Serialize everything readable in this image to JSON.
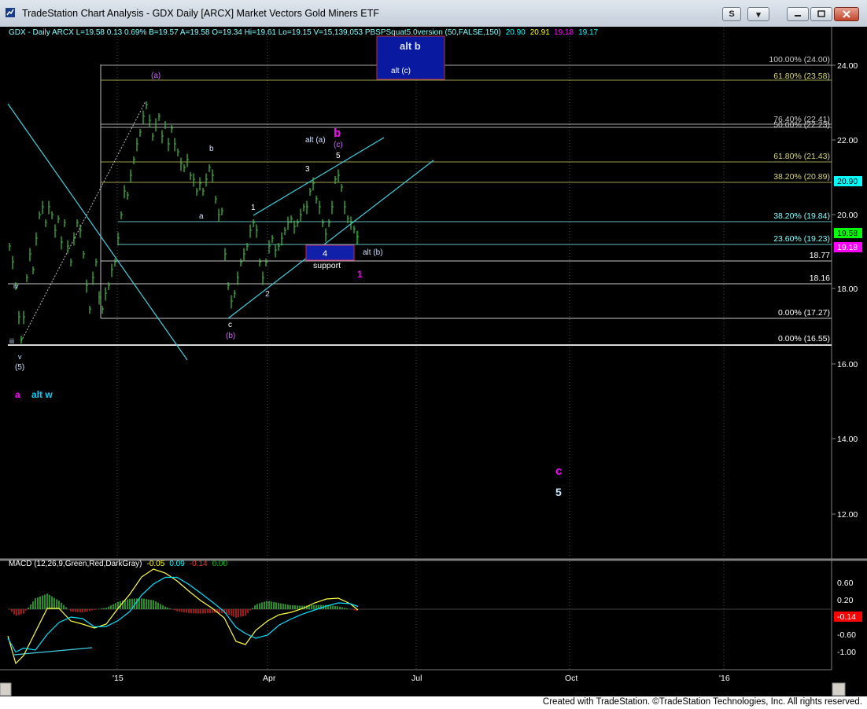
{
  "window": {
    "title": "TradeStation Chart Analysis - GDX Daily [ARCX] Market Vectors Gold Miners ETF",
    "buttons": {
      "s": "S",
      "menu": "▾"
    }
  },
  "status_bar": {
    "credit": "Created with TradeStation. ©TradeStation Technologies, Inc. All rights reserved."
  },
  "price_header": {
    "items": [
      {
        "text": "GDX - Daily  ARCX  L=19.58  0.13  0.69%  B=19.57  A=19.58  O=19.34  Hi=19.61  Lo=19.15  V=15,139,053  PBSPSquat5.0version (50,FALSE,150)",
        "color": "#7fffff"
      },
      {
        "text": "20.90",
        "color": "#00ffff"
      },
      {
        "text": "20.91",
        "color": "#ffff00"
      },
      {
        "text": "19.18",
        "color": "#ff00ff"
      },
      {
        "text": "19.17",
        "color": "#00ffff"
      }
    ]
  },
  "macd_header": {
    "items": [
      {
        "text": "MACD (12,26,9,Green,Red,DarkGray)",
        "color": "#ffffff"
      },
      {
        "text": "-0.05",
        "color": "#ffff00"
      },
      {
        "text": "0.09",
        "color": "#00ffff"
      },
      {
        "text": "-0.14",
        "color": "#ff3030"
      },
      {
        "text": "0.00",
        "color": "#00c000"
      }
    ]
  },
  "price_axis": {
    "ticks": [
      "24.00",
      "22.00",
      "20.00",
      "18.00",
      "16.00",
      "14.00",
      "12.00"
    ]
  },
  "macd_axis": {
    "ticks": [
      "0.60",
      "0.20",
      "-0.20",
      "-0.60",
      "-1.00"
    ]
  },
  "price_markers": [
    {
      "label": "20.90",
      "bg": "#00ffff",
      "fg": "#000000"
    },
    {
      "label": "19.58",
      "bg": "#00ff00",
      "fg": "#000000"
    },
    {
      "label": "19.18",
      "bg": "#ff00ff",
      "fg": "#ffffff"
    }
  ],
  "macd_marker": {
    "label": "-0.14",
    "bg": "#ff0000",
    "fg": "#ffffff"
  },
  "x_axis": {
    "labels": [
      "'15",
      "Apr",
      "Jul",
      "Oct",
      "'16"
    ]
  },
  "fib_levels": [
    {
      "label": "100.00% (24.00)",
      "color": "#c8c8c8"
    },
    {
      "label": "61.80% (23.58)",
      "color": "#d8d870"
    },
    {
      "label": "76.40% (22.41)",
      "color": "#c8c8c8"
    },
    {
      "label": "50.00% (22.23)",
      "color": "#c8c8c8"
    },
    {
      "label": "61.80% (21.43)",
      "color": "#d8d870"
    },
    {
      "label": "38.20% (20.89)",
      "color": "#d8d870"
    },
    {
      "label": "38.20% (19.84)",
      "color": "#80ffff"
    },
    {
      "label": "23.60% (19.23)",
      "color": "#80ffff"
    },
    {
      "label": "18.77",
      "color": "#ffffff"
    },
    {
      "label": "18.16",
      "color": "#ffffff"
    },
    {
      "label": "0.00% (17.27)",
      "color": "#ffffff"
    },
    {
      "label": "0.00% (16.55)",
      "color": "#ffffff"
    }
  ],
  "boxes": {
    "alt_b": {
      "title": "alt b",
      "sub": "alt (c)"
    },
    "support": {
      "inner": "4",
      "caption": "support"
    }
  },
  "wave_labels": [
    {
      "text": "(a)",
      "color": "#d060ff"
    },
    {
      "text": "b",
      "color": "#d0e0ff"
    },
    {
      "text": "a",
      "color": "#d0e0ff"
    },
    {
      "text": "1",
      "color": "#ffffff"
    },
    {
      "text": "2",
      "color": "#d0e0ff"
    },
    {
      "text": "3",
      "color": "#ffffff"
    },
    {
      "text": "4",
      "color": "#ffffff"
    },
    {
      "text": "5",
      "color": "#ffffff"
    },
    {
      "text": "c",
      "color": "#ffffff"
    },
    {
      "text": "(b)",
      "color": "#d060ff"
    },
    {
      "text": "(c)",
      "color": "#d060ff"
    },
    {
      "text": "alt (a)",
      "color": "#d0e0ff"
    },
    {
      "text": "b",
      "color": "#ff00ff"
    },
    {
      "text": "alt (b)",
      "color": "#d0e0ff"
    },
    {
      "text": "1",
      "color": "#ff00ff"
    },
    {
      "text": "iv",
      "color": "#d0e0ff"
    },
    {
      "text": "iii",
      "color": "#d0e0ff"
    },
    {
      "text": "v",
      "color": "#d0e0ff"
    },
    {
      "text": "(5)",
      "color": "#d0e0ff"
    },
    {
      "text": "a",
      "color": "#ff00ff"
    },
    {
      "text": "alt w",
      "color": "#00d0ff"
    },
    {
      "text": "c",
      "color": "#ff00ff"
    },
    {
      "text": "5",
      "color": "#c0e8ff"
    }
  ]
}
